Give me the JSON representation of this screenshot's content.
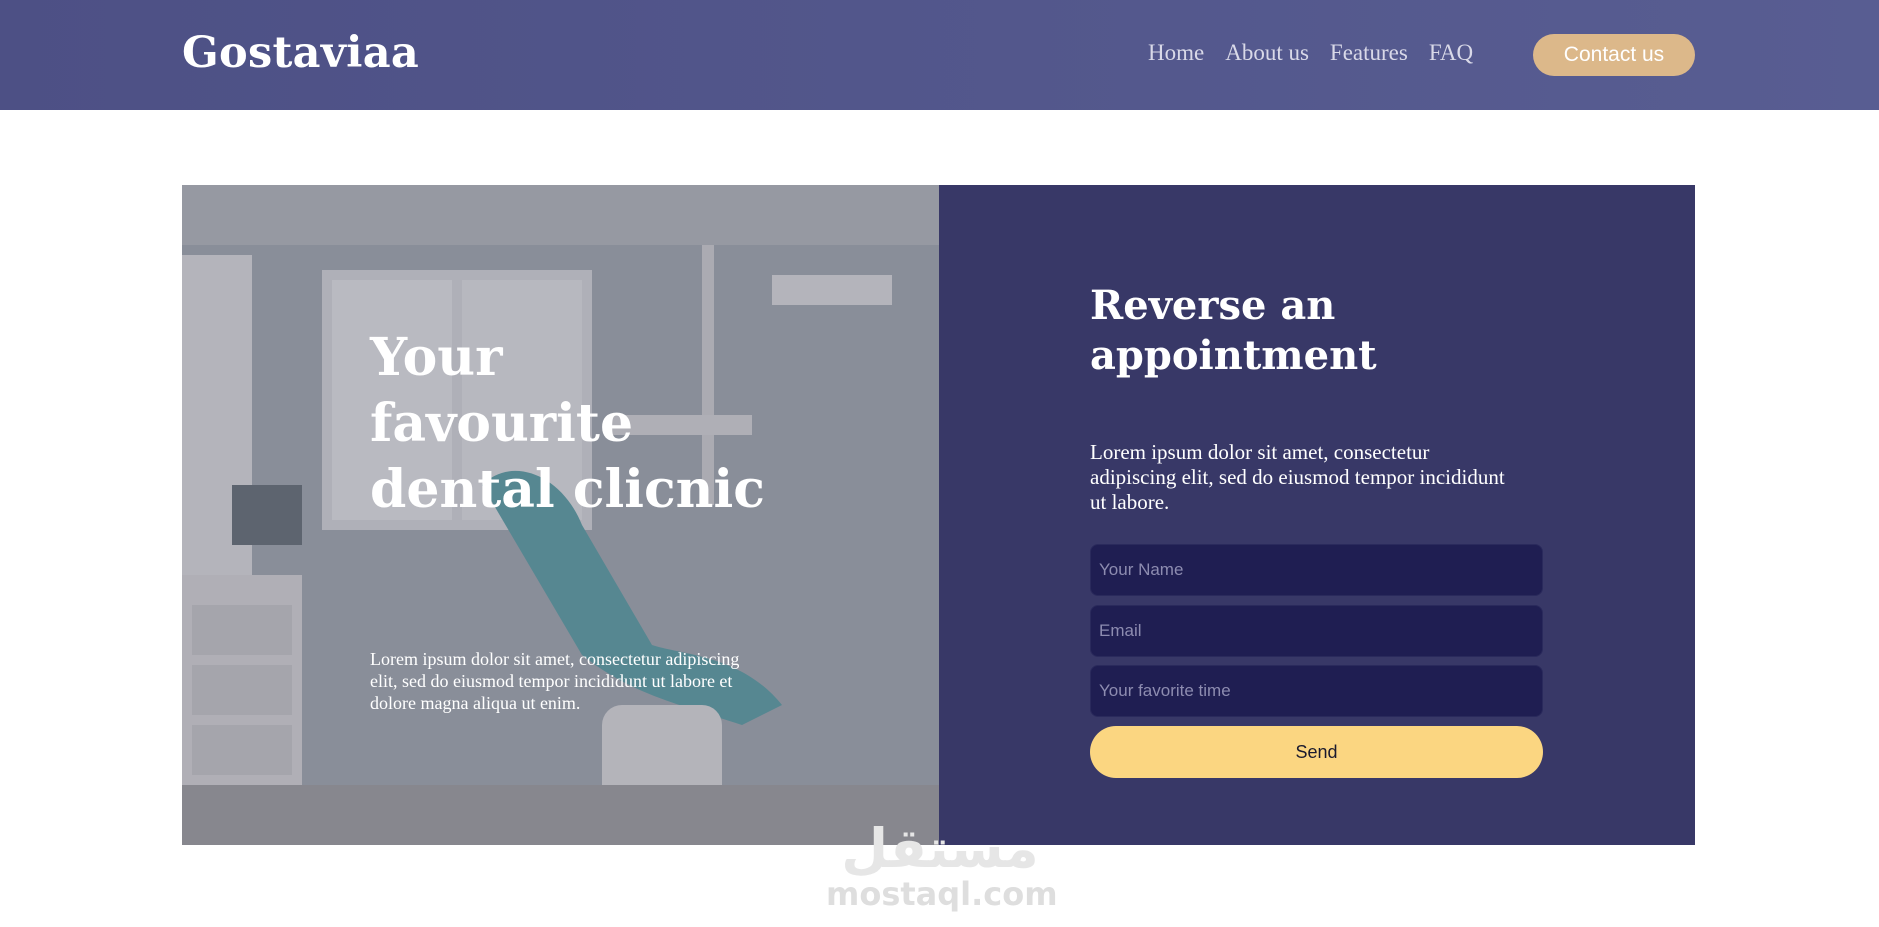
{
  "header": {
    "brand": "Gostaviaa",
    "nav": [
      "Home",
      "About us",
      "Features",
      "FAQ"
    ],
    "cta_label": "Contact us"
  },
  "hero": {
    "title": "Your favourite dental clicnic",
    "description": "Lorem ipsum dolor sit amet, consectetur adipiscing elit, sed do eiusmod tempor incididunt ut labore et dolore magna aliqua ut enim."
  },
  "appointment": {
    "title": "Reverse an appointment",
    "description": "Lorem ipsum dolor sit amet, consectetur adipiscing elit, sed do eiusmod tempor incididunt ut labore.",
    "fields": {
      "name_placeholder": "Your Name",
      "email_placeholder": "Email",
      "time_placeholder": "Your favorite time"
    },
    "submit_label": "Send"
  },
  "watermark": {
    "arabic": "مستقل",
    "latin": "mostaql.com"
  },
  "colors": {
    "navbar": "#525689",
    "cta": "#dcb88a",
    "panel": "#383867",
    "field": "#1f1e52",
    "send": "#fbd681"
  }
}
